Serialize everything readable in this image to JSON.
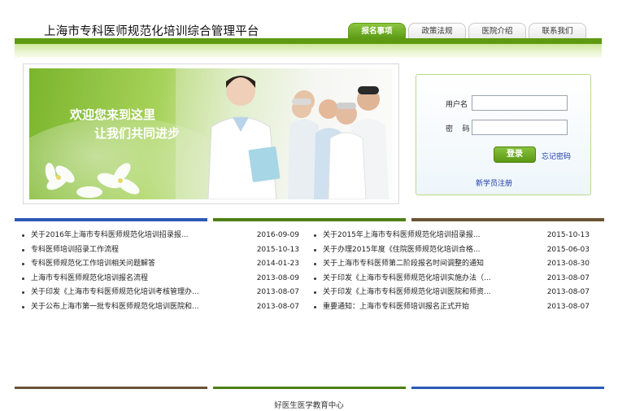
{
  "header": {
    "site_title": "上海市专科医师规范化培训综合管理平台",
    "nav": [
      "报名事项",
      "政策法规",
      "医院介绍",
      "联系我们"
    ],
    "active_tab": "报名事项"
  },
  "banner": {
    "line1": "欢迎您来到这里",
    "line2": "让我们共同进步"
  },
  "login": {
    "username_label": "用户名",
    "password_label": "密    码",
    "username_value": "",
    "password_value": "",
    "login_button": "登录",
    "forgot_password": "忘记密码",
    "register": "新学员注册"
  },
  "news_left": [
    {
      "title": "关于2016年上海市专科医师规范化培训招录报...",
      "date": "2016-09-09"
    },
    {
      "title": "专科医师培训招录工作流程",
      "date": "2015-10-13"
    },
    {
      "title": "专科医师规范化工作培训相关问题解答",
      "date": "2014-01-23"
    },
    {
      "title": "上海市专科医师规范化培训报名流程",
      "date": "2013-08-09"
    },
    {
      "title": "关于印发《上海市专科医师规范化培训考核管理办...",
      "date": "2013-08-07"
    },
    {
      "title": "关于公布上海市第一批专科医师规范化培训医院和...",
      "date": "2013-08-07"
    }
  ],
  "news_right": [
    {
      "title": "关于2015年上海市专科医师规范化培训招录报...",
      "date": "2015-10-13"
    },
    {
      "title": "关于办理2015年度《住院医师规范化培训合格...",
      "date": "2015-06-03"
    },
    {
      "title": "关于上海市专科医师第二阶段报名时间调整的通知",
      "date": "2013-08-30"
    },
    {
      "title": "关于印发《上海市专科医师规范化培训实施办法（...",
      "date": "2013-08-07"
    },
    {
      "title": "关于印发《上海市专科医师规范化培训医院和师资...",
      "date": "2013-08-07"
    },
    {
      "title": "重要通知：上海市专科医师培训报名正式开始",
      "date": "2013-08-07"
    }
  ],
  "footer": {
    "text": "好医生医学教育中心"
  },
  "colors": {
    "green": "#5e9a12",
    "blue": "#2a5ab5",
    "brown": "#6b5335",
    "link": "#1b38a8"
  }
}
